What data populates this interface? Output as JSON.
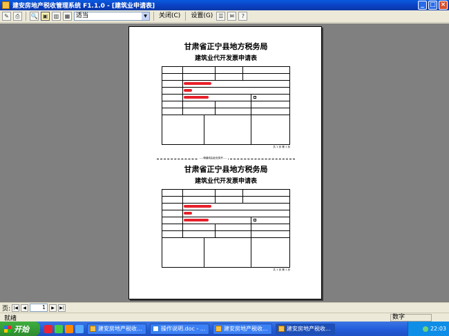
{
  "window": {
    "title": "建安房地产税收管理系统 F1.1.0 - [建筑业申请表]",
    "controls": [
      "_",
      "□",
      "×"
    ]
  },
  "toolbar": {
    "icons": [
      "✎",
      "⎙",
      "🔍",
      "▣",
      "▥",
      "▦"
    ],
    "zoom_value": "适当",
    "close_label": "关闭(C)",
    "settings_label": "设置(G)",
    "extra_icons": [
      "☰",
      "✉",
      "?"
    ]
  },
  "document": {
    "title1": "甘肃省正宁县地方税务局",
    "title2": "建筑业代开发票申请表",
    "cut_label": "----骑缝线由此处剪开----",
    "page_label": "共 1 页  第 1 页"
  },
  "nav": {
    "page_label": "页:",
    "page_value": "1",
    "buttons": [
      "|◀",
      "◀",
      "▶",
      "▶|"
    ]
  },
  "status": {
    "text": "就绪",
    "panel": "数字"
  },
  "taskbar": {
    "start_label": "开始",
    "tasks": [
      {
        "label": "建安房地产税收..."
      },
      {
        "label": "操作说明.doc - ..."
      },
      {
        "label": "建安房地产税收..."
      },
      {
        "label": "建安房地产税收..."
      }
    ],
    "clock": "22:03"
  }
}
